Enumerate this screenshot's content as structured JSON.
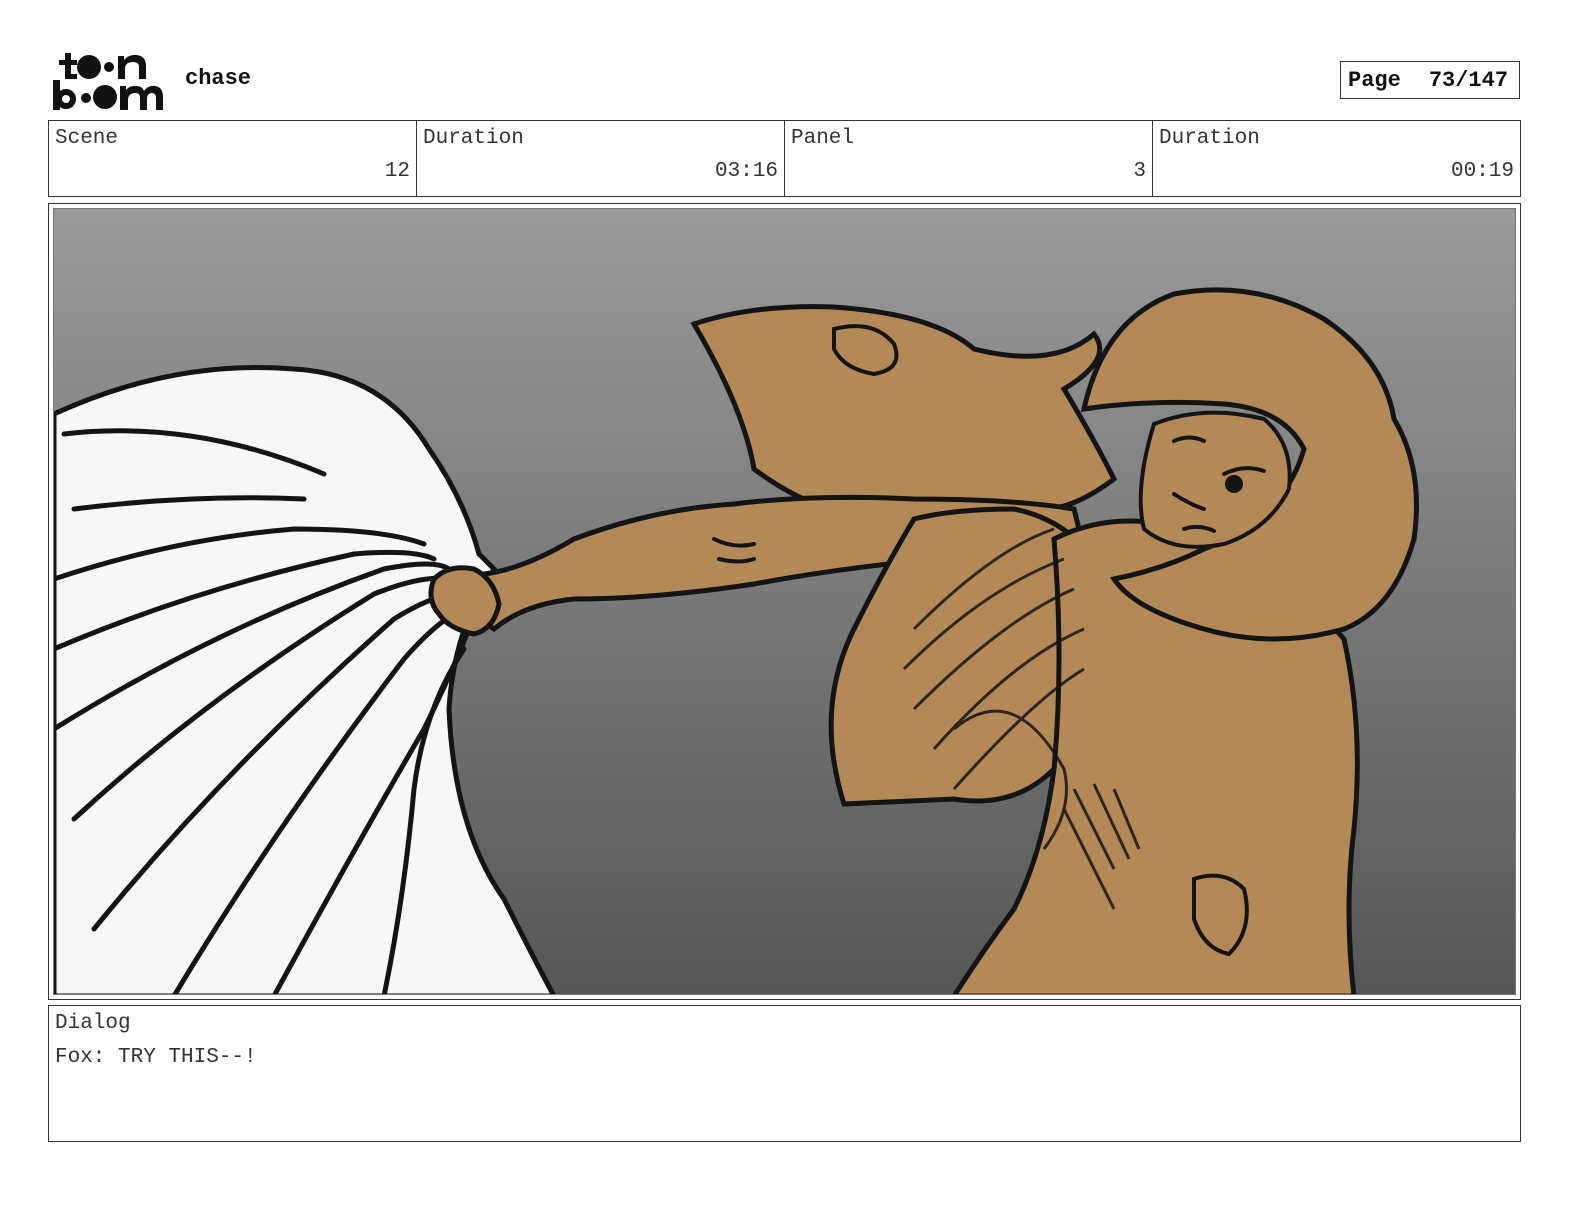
{
  "header": {
    "logo_icon": "toonboom-logo",
    "project_title": "chase",
    "page_label": "Page",
    "page_value": "73/147"
  },
  "info": [
    {
      "caption": "Scene",
      "value": "12"
    },
    {
      "caption": "Duration",
      "value": "03:16"
    },
    {
      "caption": "Panel",
      "value": "3"
    },
    {
      "caption": "Duration",
      "value": "00:19"
    }
  ],
  "panel": {
    "image_icon": "storyboard-drawing-character-grabbing-cloth",
    "colors": {
      "bg_top": "#9a9a9a",
      "bg_bottom": "#565656",
      "skin": "#b38a57",
      "cloth": "#f7f7f7",
      "line": "#141414"
    }
  },
  "dialog": {
    "caption": "Dialog",
    "text": "Fox: TRY THIS--!"
  }
}
